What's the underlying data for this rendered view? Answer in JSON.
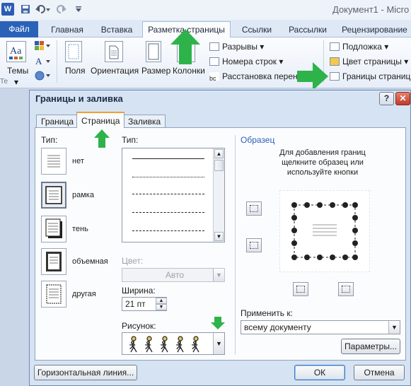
{
  "app": {
    "logo": "W",
    "title": "Документ1  -  Micro"
  },
  "ribbon": {
    "tabs": [
      "Файл",
      "Главная",
      "Вставка",
      "Разметка страницы",
      "Ссылки",
      "Рассылки",
      "Рецензирование"
    ],
    "active_tab": "Разметка страницы",
    "buttons": {
      "themes": "Темы",
      "themes_group_stub": "Те",
      "fields": "Поля",
      "orientation": "Ориентация",
      "size": "Размер",
      "columns": "Колонки",
      "breaks": "Разрывы",
      "line_numbers": "Номера строк",
      "hyphenation": "Расстановка перено",
      "watermark": "Подложка",
      "page_color": "Цвет страницы",
      "page_borders": "Границы страниц"
    },
    "accent_color": "#2a62b8",
    "arrow_color": "#2eb34a"
  },
  "dialog": {
    "title": "Границы и заливка",
    "help": "?",
    "close": "✕",
    "tabs": [
      "Граница",
      "Страница",
      "Заливка"
    ],
    "selected_tab": "Страница",
    "type_label": "Тип:",
    "types": [
      "нет",
      "рамка",
      "тень",
      "объемная",
      "другая"
    ],
    "selected_type": "рамка",
    "style_label": "Тип:",
    "color_label": "Цвет:",
    "color_value": "Авто",
    "width_label": "Ширина:",
    "width_value": "21 пт",
    "art_label": "Рисунок:",
    "preview_label": "Образец",
    "preview_hint": "Для добавления границ щелкните образец или используйте кнопки",
    "apply_label": "Применить к:",
    "apply_value": "всему документу",
    "options_button": "Параметры...",
    "horizontal_line_button": "Горизонтальная линия...",
    "ok_button": "ОК",
    "cancel_button": "Отмена"
  }
}
